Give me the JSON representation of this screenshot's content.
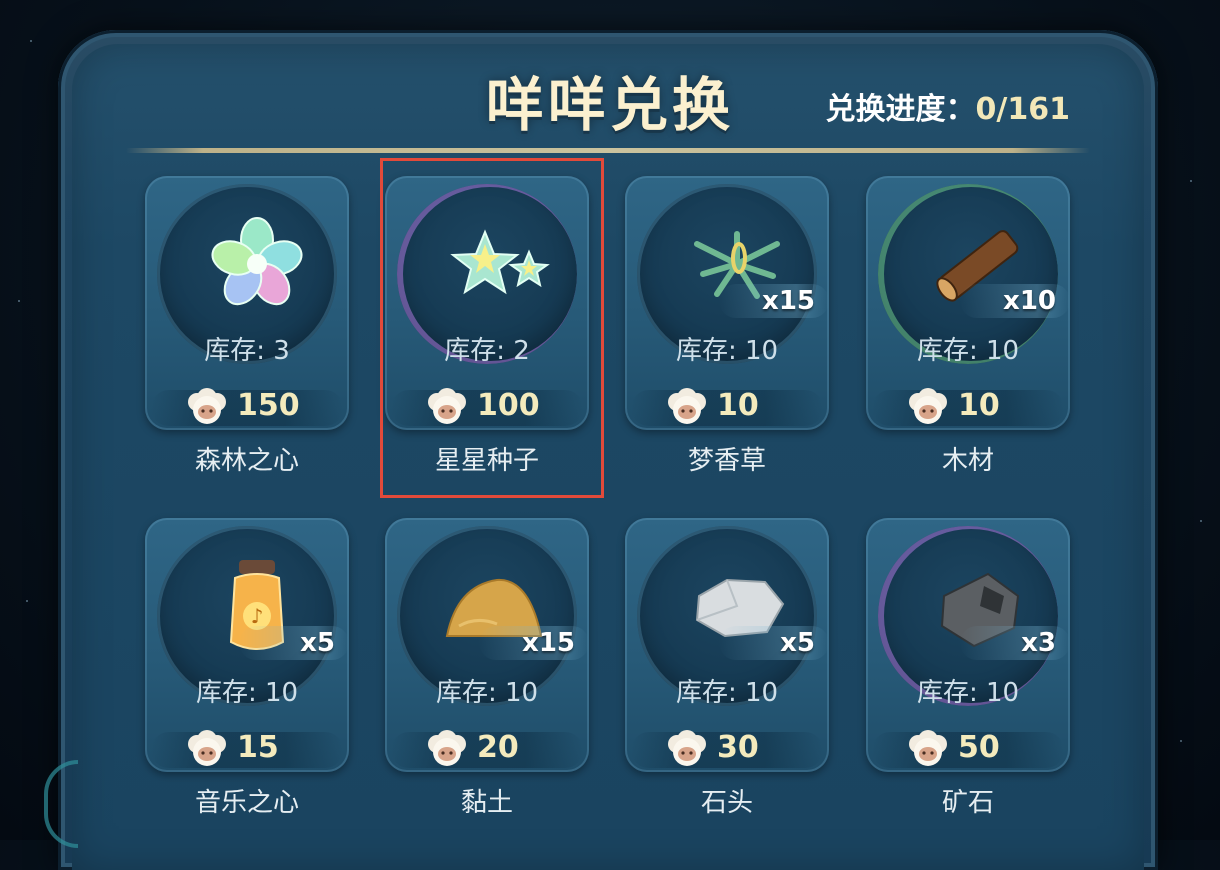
{
  "title": "咩咩兑换",
  "progress": {
    "label": "兑换进度：",
    "value": "0/161"
  },
  "stock_prefix": "库存: ",
  "items": [
    {
      "name": "森林之心",
      "icon": "flower-icon",
      "stock": "3",
      "price": "150",
      "qty": "",
      "ring": ""
    },
    {
      "name": "星星种子",
      "icon": "star-seed-icon",
      "stock": "2",
      "price": "100",
      "qty": "",
      "ring": "purple"
    },
    {
      "name": "梦香草",
      "icon": "grass-bundle-icon",
      "stock": "10",
      "price": "10",
      "qty": "x15",
      "ring": ""
    },
    {
      "name": "木材",
      "icon": "wood-log-icon",
      "stock": "10",
      "price": "10",
      "qty": "x10",
      "ring": "green"
    },
    {
      "name": "音乐之心",
      "icon": "music-jar-icon",
      "stock": "10",
      "price": "15",
      "qty": "x5",
      "ring": ""
    },
    {
      "name": "黏土",
      "icon": "clay-icon",
      "stock": "10",
      "price": "20",
      "qty": "x15",
      "ring": ""
    },
    {
      "name": "石头",
      "icon": "stone-icon",
      "stock": "10",
      "price": "30",
      "qty": "x5",
      "ring": ""
    },
    {
      "name": "矿石",
      "icon": "ore-icon",
      "stock": "10",
      "price": "50",
      "qty": "x3",
      "ring": "purple"
    }
  ],
  "currency_icon": "sheep-coin-icon",
  "selected_item": "星星种子",
  "colors": {
    "highlight": "#e24a3a",
    "panel": "#1d4864",
    "price": "#f4ebbd"
  }
}
